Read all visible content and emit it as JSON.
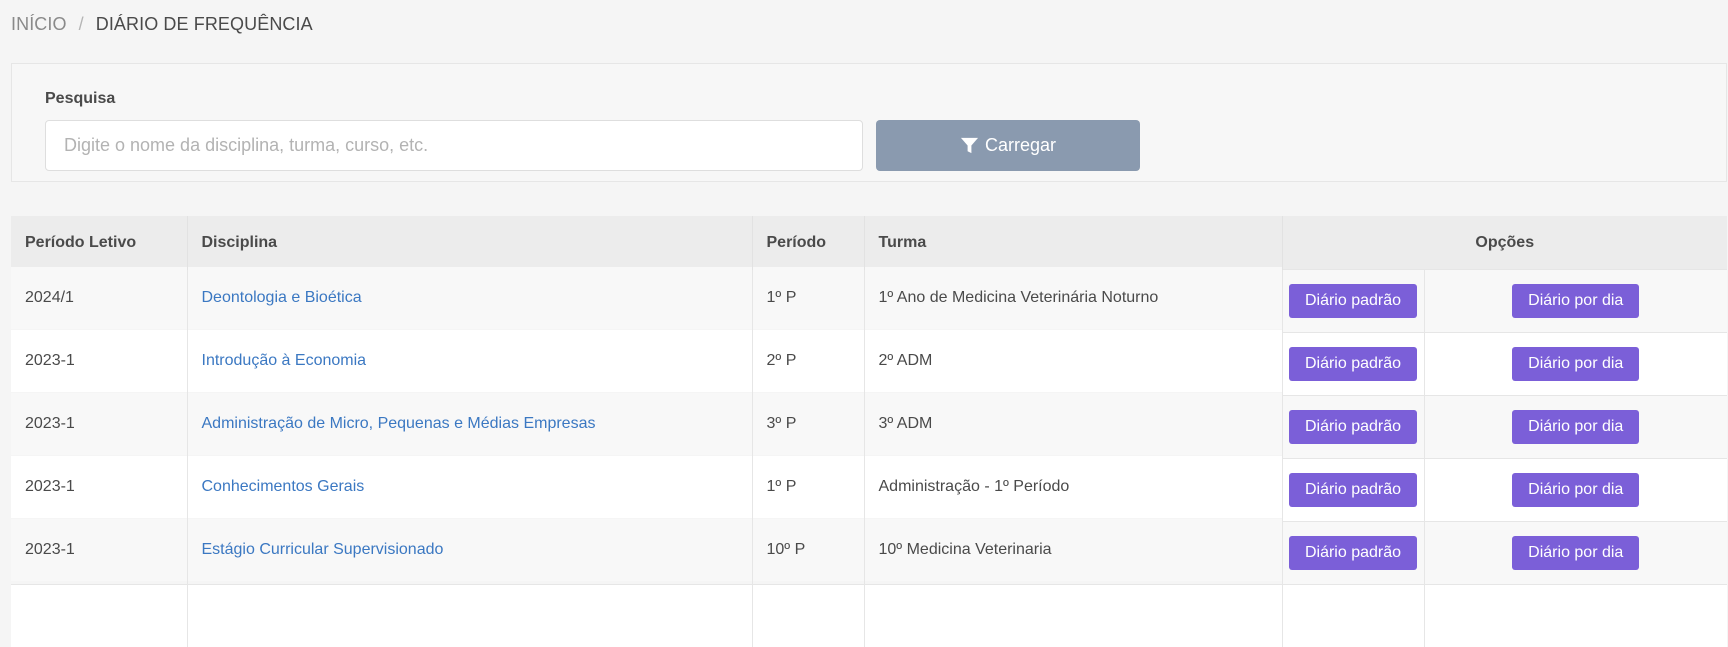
{
  "breadcrumb": {
    "home": "INÍCIO",
    "separator": "/",
    "current": "DIÁRIO DE FREQUÊNCIA"
  },
  "search": {
    "label": "Pesquisa",
    "placeholder": "Digite o nome da disciplina, turma, curso, etc.",
    "value": "",
    "button_label": "Carregar",
    "button_icon": "filter-icon"
  },
  "table": {
    "headers": {
      "periodo_letivo": "Período Letivo",
      "disciplina": "Disciplina",
      "periodo": "Período",
      "turma": "Turma",
      "opcoes": "Opções"
    },
    "rows": [
      {
        "periodo_letivo": "2024/1",
        "disciplina": "Deontologia e Bioética",
        "periodo": "1º P",
        "turma": "1º Ano de Medicina Veterinária Noturno",
        "btn_padrao": "Diário padrão",
        "btn_dia": "Diário por dia"
      },
      {
        "periodo_letivo": "2023-1",
        "disciplina": "Introdução à Economia",
        "periodo": "2º P",
        "turma": "2º ADM",
        "btn_padrao": "Diário padrão",
        "btn_dia": "Diário por dia"
      },
      {
        "periodo_letivo": "2023-1",
        "disciplina": "Administração de Micro, Pequenas e Médias Empresas",
        "periodo": "3º P",
        "turma": "3º ADM",
        "btn_padrao": "Diário padrão",
        "btn_dia": "Diário por dia"
      },
      {
        "periodo_letivo": "2023-1",
        "disciplina": "Conhecimentos Gerais",
        "periodo": "1º P",
        "turma": "Administração - 1º Período",
        "btn_padrao": "Diário padrão",
        "btn_dia": "Diário por dia"
      },
      {
        "periodo_letivo": "2023-1",
        "disciplina": "Estágio Curricular Supervisionado",
        "periodo": "10º P",
        "turma": "10º Medicina Veterinaria",
        "btn_padrao": "Diário padrão",
        "btn_dia": "Diário por dia"
      },
      {
        "periodo_letivo": "",
        "disciplina": "",
        "periodo": "",
        "turma": "",
        "btn_padrao": "",
        "btn_dia": ""
      }
    ]
  },
  "colors": {
    "link": "#3b78c2",
    "button_primary": "#7b5fd8",
    "button_load": "#8a9aaf",
    "header_bg": "#ececec"
  }
}
